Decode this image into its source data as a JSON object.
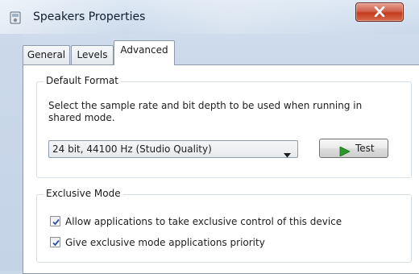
{
  "window": {
    "title": "Speakers Properties",
    "close_symbol": "X",
    "icon": "speaker-properties-icon"
  },
  "tabs": [
    {
      "label": "General",
      "active": false
    },
    {
      "label": "Levels",
      "active": false
    },
    {
      "label": "Advanced",
      "active": true
    }
  ],
  "default_format": {
    "legend": "Default Format",
    "description": "Select the sample rate and bit depth to be used when running in shared mode.",
    "selected_value": "24 bit, 44100 Hz (Studio Quality)",
    "test_label": "Test"
  },
  "exclusive_mode": {
    "legend": "Exclusive Mode",
    "options": [
      {
        "label": "Allow applications to take exclusive control of this device",
        "checked": true
      },
      {
        "label": "Give exclusive mode applications priority",
        "checked": true
      }
    ]
  },
  "colors": {
    "close_button": "#c43b1f",
    "test_play_icon": "#2a9a2a",
    "checkmark": "#2d4f9e"
  }
}
